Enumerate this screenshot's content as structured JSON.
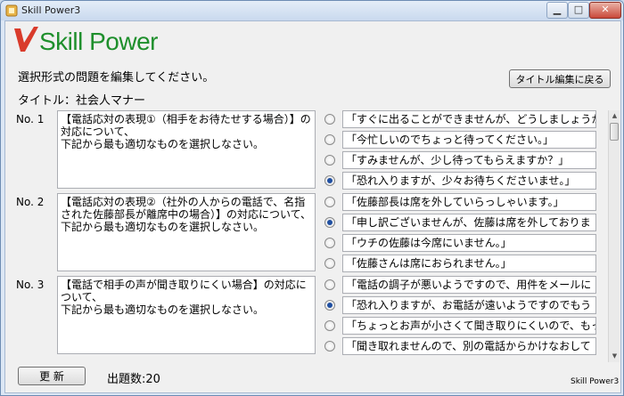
{
  "window": {
    "title": "Skill Power3",
    "controls": {
      "minimize": "▁",
      "maximize": "□",
      "close": "✕"
    }
  },
  "logo": {
    "text": "Skill Power",
    "colors": {
      "mark": "#d93b2b",
      "text": "#1e8f2c"
    }
  },
  "header": {
    "instruction": "選択形式の問題を編集してください。",
    "title_line": "タイトル：社会人マナー",
    "back_button": "タイトル編集に戻る"
  },
  "questions": [
    {
      "no": "No. 1",
      "text": "【電話応対の表現①（相手をお待たせする場合）】の対応について、\n下記から最も適切なものを選択しなさい。",
      "options": [
        {
          "text": "「すぐに出ることができませんが、どうしましょうか？",
          "selected": false
        },
        {
          "text": "「今忙しいのでちょっと待ってください。」",
          "selected": false
        },
        {
          "text": "「すみませんが、少し待ってもらえますか？」",
          "selected": false
        },
        {
          "text": "「恐れ入りますが、少々お待ちくださいませ。」",
          "selected": true
        }
      ]
    },
    {
      "no": "No. 2",
      "text": "【電話応対の表現②（社外の人からの電話で、名指された佐藤部長が離席中の場合）】の対応について、\n下記から最も適切なものを選択しなさい。",
      "options": [
        {
          "text": "「佐藤部長は席を外していらっしゃいます。」",
          "selected": false
        },
        {
          "text": "「申し訳ございませんが、佐藤は席を外しておりま",
          "selected": true
        },
        {
          "text": "「ウチの佐藤は今席にいません。」",
          "selected": false
        },
        {
          "text": "「佐藤さんは席におられません。」",
          "selected": false
        }
      ]
    },
    {
      "no": "No. 3",
      "text": "【電話で相手の声が聞き取りにくい場合】の対応について、\n下記から最も適切なものを選択しなさい。",
      "options": [
        {
          "text": "「電話の調子が悪いようですので、用件をメールに",
          "selected": false
        },
        {
          "text": "「恐れ入りますが、お電話が遠いようですのでもう",
          "selected": true
        },
        {
          "text": "「ちょっとお声が小さくて聞き取りにくいので、もっと",
          "selected": false
        },
        {
          "text": "「聞き取れませんので、別の電話からかけなおして",
          "selected": false
        }
      ]
    }
  ],
  "footer": {
    "update_button": "更 新",
    "count": "出題数:20",
    "brand": "Skill Power3"
  }
}
